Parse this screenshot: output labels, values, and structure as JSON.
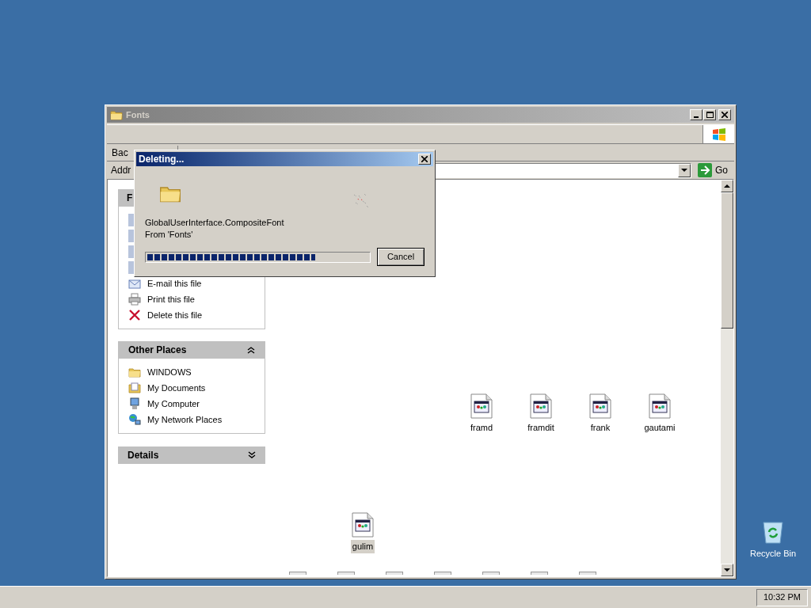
{
  "window": {
    "title": "Fonts",
    "active": false
  },
  "toolbar": {
    "back_fragment": "Bac"
  },
  "address": {
    "label_fragment": "Addr",
    "go": "Go"
  },
  "tasks_panel": {
    "title_fragment": "F",
    "items": [
      {
        "label": "E-mail this file",
        "kind": "mail"
      },
      {
        "label": "Print this file",
        "kind": "printer"
      },
      {
        "label": "Delete this file",
        "kind": "delete"
      }
    ]
  },
  "other_places": {
    "title": "Other Places",
    "expanded": true,
    "items": [
      {
        "label": "WINDOWS",
        "kind": "folder"
      },
      {
        "label": "My Documents",
        "kind": "documents"
      },
      {
        "label": "My Computer",
        "kind": "computer"
      },
      {
        "label": "My Network Places",
        "kind": "network"
      }
    ]
  },
  "details": {
    "title": "Details",
    "expanded": false
  },
  "files": [
    {
      "name": "framd",
      "selected": false
    },
    {
      "name": "framdit",
      "selected": false
    },
    {
      "name": "frank",
      "selected": false
    },
    {
      "name": "gautami",
      "selected": false
    },
    {
      "name": "gulim",
      "selected": true
    }
  ],
  "dialog": {
    "title": "Deleting...",
    "file": "GlobalUserInterface.CompositeFont",
    "from": "From 'Fonts'",
    "level": 0.76,
    "cancel": "Cancel"
  },
  "desktop": {
    "icons": [
      {
        "label": "Recycle Bin"
      }
    ]
  },
  "taskbar": {
    "clock": "10:32 PM"
  }
}
